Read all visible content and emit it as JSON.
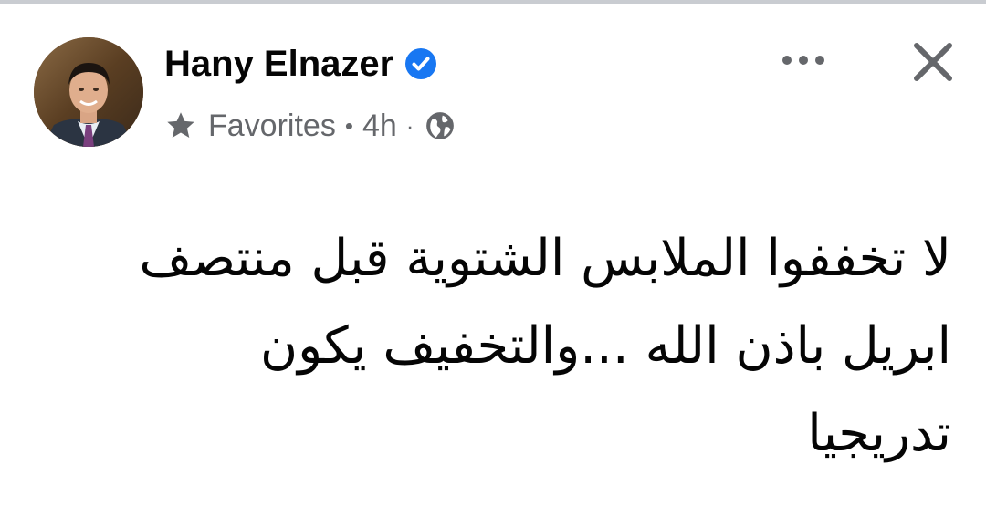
{
  "post": {
    "author": {
      "name": "Hany Elnazer",
      "verified": true,
      "avatar_icon": "profile-photo"
    },
    "meta": {
      "audience_label": "Favorites",
      "bullet": "•",
      "time": "4h",
      "dot": "·",
      "privacy_icon": "globe-icon",
      "favorites_icon": "star-icon"
    },
    "actions": {
      "more_icon": "more-horizontal-icon",
      "close_icon": "close-icon"
    },
    "text": "لا تخففوا الملابس الشتوية قبل منتصف\nابريل باذن الله ...والتخفيف يكون\nتدريجيا"
  },
  "colors": {
    "text_primary": "#050505",
    "text_secondary": "#65676b",
    "verified_blue": "#1877f2",
    "icon_gray": "#65676b"
  }
}
